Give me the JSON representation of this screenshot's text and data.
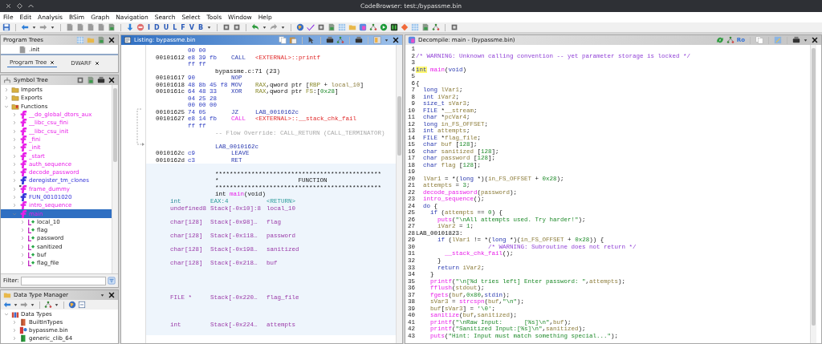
{
  "window": {
    "title": "CodeBrowser: test:/bypassme.bin"
  },
  "menu": [
    "File",
    "Edit",
    "Analysis",
    "BSim",
    "Graph",
    "Navigation",
    "Search",
    "Select",
    "Tools",
    "Window",
    "Help"
  ],
  "toolbar": {
    "letters": [
      "I",
      "D",
      "U",
      "L",
      "F",
      "V",
      "B"
    ]
  },
  "program_trees": {
    "title": "Program Trees",
    "focused": false,
    "rows": [
      ".init"
    ],
    "tabs": [
      {
        "label": "Program Tree",
        "selected": true
      },
      {
        "label": "DWARF",
        "selected": false
      }
    ]
  },
  "symbol_tree": {
    "title": "Symbol Tree",
    "focused": false,
    "items": [
      {
        "label": "Imports",
        "kind": "folder",
        "expanded": false,
        "selected": false
      },
      {
        "label": "Exports",
        "kind": "folder",
        "expanded": false,
        "selected": false
      },
      {
        "label": "Functions",
        "kind": "folder",
        "expanded": true,
        "selected": false,
        "children": [
          {
            "label": "__do_global_dtors_aux",
            "kind": "function",
            "color": "#e81ee8",
            "expanded": false,
            "selected": false
          },
          {
            "label": "__libc_csu_fini",
            "kind": "function",
            "color": "#e81ee8",
            "expanded": false,
            "selected": false
          },
          {
            "label": "__libc_csu_init",
            "kind": "function",
            "color": "#e81ee8",
            "expanded": false,
            "selected": false
          },
          {
            "label": "_fini",
            "kind": "function",
            "color": "#e81ee8",
            "expanded": false,
            "selected": false
          },
          {
            "label": "_init",
            "kind": "function",
            "color": "#e81ee8",
            "expanded": false,
            "selected": false
          },
          {
            "label": "_start",
            "kind": "function",
            "color": "#e81ee8",
            "expanded": false,
            "selected": false
          },
          {
            "label": "auth_sequence",
            "kind": "function",
            "color": "#e81ee8",
            "expanded": false,
            "selected": false
          },
          {
            "label": "decode_password",
            "kind": "function",
            "color": "#e81ee8",
            "expanded": false,
            "selected": false
          },
          {
            "label": "deregister_tm_clones",
            "kind": "function",
            "color": "#3434d8",
            "expanded": false,
            "selected": false
          },
          {
            "label": "frame_dummy",
            "kind": "function-marked",
            "color": "#e81ee8",
            "expanded": false,
            "selected": false
          },
          {
            "label": "FUN_00101020",
            "kind": "function",
            "color": "#3434d8",
            "expanded": false,
            "selected": false
          },
          {
            "label": "intro_sequence",
            "kind": "function",
            "color": "#e81ee8",
            "expanded": false,
            "selected": false
          },
          {
            "label": "main",
            "kind": "function",
            "color": "#e81ee8",
            "expanded": true,
            "selected": true,
            "children": [
              {
                "label": "local_10",
                "kind": "variable",
                "expanded": false,
                "selected": false
              },
              {
                "label": "flag",
                "kind": "variable",
                "expanded": false,
                "selected": false
              },
              {
                "label": "password",
                "kind": "variable",
                "expanded": false,
                "selected": false
              },
              {
                "label": "sanitized",
                "kind": "variable",
                "expanded": false,
                "selected": false
              },
              {
                "label": "buf",
                "kind": "variable",
                "expanded": false,
                "selected": false
              },
              {
                "label": "flag_file",
                "kind": "variable",
                "expanded": false,
                "selected": false
              }
            ]
          }
        ]
      }
    ],
    "filter": {
      "label": "Filter:"
    }
  },
  "data_type_manager": {
    "title": "Data Type Manager",
    "focused": false,
    "items": [
      {
        "label": "Data Types",
        "kind": "root",
        "expanded": true,
        "selected": false,
        "children": [
          {
            "label": "BuiltInTypes",
            "kind": "builtin",
            "expanded": false,
            "selected": false
          },
          {
            "label": "bypassme.bin",
            "kind": "program",
            "expanded": false,
            "selected": false
          },
          {
            "label": "generic_clib_64",
            "kind": "archive",
            "expanded": false,
            "selected": false
          }
        ]
      }
    ]
  },
  "listing": {
    "title": "Listing:  bypassme.bin",
    "focused": true,
    "blocks": [
      {
        "kind": "code",
        "lines": [
          {
            "kind": "bytes",
            "bytes": "00 00"
          },
          {
            "kind": "instr",
            "addr": "00101612",
            "bytes": "e8 39 fb",
            "mnem": {
              "kind": "k",
              "text": "CALL"
            },
            "ops": [
              {
                "kind": "x",
                "text": "<EXTERNAL>::printf"
              }
            ]
          },
          {
            "kind": "bytes",
            "bytes": "ff ff"
          },
          {
            "kind": "source",
            "text": "bypassme.c:71 (23)"
          },
          {
            "kind": "instr",
            "addr": "00101617",
            "bytes": "90",
            "mnem": {
              "kind": "k",
              "text": "NOP"
            }
          },
          {
            "kind": "instr",
            "addr": "00101618",
            "bytes": "48 8b 45 f8",
            "mnem": {
              "kind": "k",
              "text": "MOV"
            },
            "ops": [
              {
                "kind": "r",
                "text": "RAX"
              },
              {
                "kind": "p",
                "text": ",qword ptr ["
              },
              {
                "kind": "r",
                "text": "RBP"
              },
              {
                "kind": "p",
                "text": " +"
              },
              {
                "kind": "v",
                "text": " local_10"
              },
              {
                "kind": "p",
                "text": "]"
              }
            ]
          },
          {
            "kind": "instr",
            "addr": "0010161c",
            "bytes": "64 48 33",
            "mnem": {
              "kind": "k",
              "text": "XOR"
            },
            "ops": [
              {
                "kind": "r",
                "text": "RAX"
              },
              {
                "kind": "p",
                "text": ",qword ptr"
              },
              {
                "kind": "r",
                "text": " FS"
              },
              {
                "kind": "p",
                "text": ":["
              },
              {
                "kind": "n",
                "text": "0x28"
              },
              {
                "kind": "p",
                "text": "]"
              }
            ]
          },
          {
            "kind": "bytes",
            "bytes": "04 25 28"
          },
          {
            "kind": "bytes",
            "bytes": "00 00 00"
          },
          {
            "kind": "instr",
            "addr": "00101625",
            "bytes": "74 05",
            "mnem": {
              "kind": "k",
              "text": "JZ"
            },
            "ops": [
              {
                "kind": "l",
                "text": "LAB_0010162c"
              }
            ]
          },
          {
            "kind": "instr",
            "addr": "00101627",
            "bytes": "e8 14 fb",
            "mnem": {
              "kind": "f",
              "text": "CALL"
            },
            "ops": [
              {
                "kind": "x",
                "text": "<EXTERNAL>::__stack_chk_fail"
              }
            ]
          },
          {
            "kind": "bytes",
            "bytes": "ff ff"
          },
          {
            "kind": "flow",
            "text": "-- Flow Override: CALL_RETURN (CALL_TERMINATOR)"
          },
          {
            "kind": "blank"
          },
          {
            "kind": "label",
            "text": "LAB_0010162c"
          },
          {
            "kind": "instr",
            "addr": "0010162c",
            "bytes": "c9",
            "mnem": {
              "kind": "k",
              "text": "LEAVE"
            }
          },
          {
            "kind": "instr",
            "addr": "0010162d",
            "bytes": "c3",
            "mnem": {
              "kind": "k",
              "text": "RET"
            }
          }
        ]
      },
      {
        "kind": "function",
        "lines": [
          {
            "kind": "blank"
          },
          {
            "kind": "stars",
            "text": "**********************************************"
          },
          {
            "kind": "stars",
            "text": "*                      FUNCTION"
          },
          {
            "kind": "stars",
            "text": "**********************************************"
          },
          {
            "kind": "signature",
            "tokens": [
              {
                "kind": "p",
                "text": "int"
              },
              {
                "kind": "f",
                "text": " main"
              },
              {
                "kind": "p",
                "text": "(void)"
              }
            ]
          },
          {
            "kind": "return-var",
            "type": "int",
            "storage": "EAX:4",
            "name": "<RETURN>"
          },
          {
            "kind": "var",
            "type": "undefined8",
            "storage": "Stack[-0x10]:8",
            "name": "local_10"
          },
          {
            "kind": "blank"
          },
          {
            "kind": "var",
            "type": "char[128]",
            "storage": "Stack[-0x98]…",
            "name": "flag"
          },
          {
            "kind": "blank"
          },
          {
            "kind": "var",
            "type": "char[128]",
            "storage": "Stack[-0x118…",
            "name": "password"
          },
          {
            "kind": "blank"
          },
          {
            "kind": "var",
            "type": "char[128]",
            "storage": "Stack[-0x198…",
            "name": "sanitized"
          },
          {
            "kind": "blank"
          },
          {
            "kind": "var",
            "type": "char[128]",
            "storage": "Stack[-0x218…",
            "name": "buf"
          },
          {
            "kind": "blank"
          },
          {
            "kind": "blank"
          },
          {
            "kind": "blank"
          },
          {
            "kind": "blank"
          },
          {
            "kind": "var",
            "type": "FILE *",
            "storage": "Stack[-0x220…",
            "name": "flag_file"
          },
          {
            "kind": "blank"
          },
          {
            "kind": "blank"
          },
          {
            "kind": "blank"
          },
          {
            "kind": "var",
            "type": "int",
            "storage": "Stack[-0x224…",
            "name": "attempts"
          },
          {
            "kind": "blank"
          }
        ]
      }
    ]
  },
  "decompile": {
    "title": "Decompile: main -  (bypassme.bin)",
    "focused": false,
    "toolbar_text": "Ro",
    "lines": [
      {
        "num": "1"
      },
      {
        "num": "2",
        "tokens": [
          {
            "kind": "c",
            "text": "/* WARNING: Unknown calling convention -- yet parameter storage is locked */"
          }
        ]
      },
      {
        "num": "3"
      },
      {
        "num": "4",
        "tokens": [
          {
            "kind": "h",
            "text": "int"
          },
          {
            "kind": "f",
            "text": " main"
          },
          {
            "kind": "p",
            "text": "("
          },
          {
            "kind": "k",
            "text": "void"
          },
          {
            "kind": "p",
            "text": ")"
          }
        ]
      },
      {
        "num": "5"
      },
      {
        "num": "6",
        "tokens": [
          {
            "kind": "p",
            "text": "{"
          }
        ]
      },
      {
        "num": "7",
        "tokens": [
          {
            "kind": "k",
            "text": "  long"
          },
          {
            "kind": "v",
            "text": " lVar1"
          },
          {
            "kind": "p",
            "text": ";"
          }
        ]
      },
      {
        "num": "8",
        "tokens": [
          {
            "kind": "k",
            "text": "  int"
          },
          {
            "kind": "v",
            "text": " iVar2"
          },
          {
            "kind": "p",
            "text": ";"
          }
        ]
      },
      {
        "num": "9",
        "tokens": [
          {
            "kind": "k",
            "text": "  size_t"
          },
          {
            "kind": "v",
            "text": " sVar3"
          },
          {
            "kind": "p",
            "text": ";"
          }
        ]
      },
      {
        "num": "10",
        "tokens": [
          {
            "kind": "k",
            "text": "  FILE"
          },
          {
            "kind": "p",
            "text": " *"
          },
          {
            "kind": "v",
            "text": "__stream"
          },
          {
            "kind": "p",
            "text": ";"
          }
        ]
      },
      {
        "num": "11",
        "tokens": [
          {
            "kind": "k",
            "text": "  char"
          },
          {
            "kind": "p",
            "text": " *"
          },
          {
            "kind": "v",
            "text": "pcVar4"
          },
          {
            "kind": "p",
            "text": ";"
          }
        ]
      },
      {
        "num": "12",
        "tokens": [
          {
            "kind": "k",
            "text": "  long"
          },
          {
            "kind": "v",
            "text": " in_FS_OFFSET"
          },
          {
            "kind": "p",
            "text": ";"
          }
        ]
      },
      {
        "num": "13",
        "tokens": [
          {
            "kind": "k",
            "text": "  int"
          },
          {
            "kind": "v",
            "text": " attempts"
          },
          {
            "kind": "p",
            "text": ";"
          }
        ]
      },
      {
        "num": "14",
        "tokens": [
          {
            "kind": "k",
            "text": "  FILE"
          },
          {
            "kind": "p",
            "text": " *"
          },
          {
            "kind": "v",
            "text": "flag_file"
          },
          {
            "kind": "p",
            "text": ";"
          }
        ]
      },
      {
        "num": "15",
        "tokens": [
          {
            "kind": "k",
            "text": "  char"
          },
          {
            "kind": "v",
            "text": " buf"
          },
          {
            "kind": "p",
            "text": " ["
          },
          {
            "kind": "n",
            "text": "128"
          },
          {
            "kind": "p",
            "text": "];"
          }
        ]
      },
      {
        "num": "16",
        "tokens": [
          {
            "kind": "k",
            "text": "  char"
          },
          {
            "kind": "v",
            "text": " sanitized"
          },
          {
            "kind": "p",
            "text": " ["
          },
          {
            "kind": "n",
            "text": "128"
          },
          {
            "kind": "p",
            "text": "];"
          }
        ]
      },
      {
        "num": "17",
        "tokens": [
          {
            "kind": "k",
            "text": "  char"
          },
          {
            "kind": "v",
            "text": " password"
          },
          {
            "kind": "p",
            "text": " ["
          },
          {
            "kind": "n",
            "text": "128"
          },
          {
            "kind": "p",
            "text": "];"
          }
        ]
      },
      {
        "num": "18",
        "tokens": [
          {
            "kind": "k",
            "text": "  char"
          },
          {
            "kind": "v",
            "text": " flag"
          },
          {
            "kind": "p",
            "text": " ["
          },
          {
            "kind": "n",
            "text": "128"
          },
          {
            "kind": "p",
            "text": "];"
          }
        ]
      },
      {
        "num": "19"
      },
      {
        "num": "20",
        "tokens": [
          {
            "kind": "v",
            "text": "  lVar1"
          },
          {
            "kind": "p",
            "text": " = *("
          },
          {
            "kind": "k",
            "text": "long"
          },
          {
            "kind": "p",
            "text": " *)("
          },
          {
            "kind": "v",
            "text": "in_FS_OFFSET"
          },
          {
            "kind": "p",
            "text": " +"
          },
          {
            "kind": "n",
            "text": " 0x28"
          },
          {
            "kind": "p",
            "text": ");"
          }
        ]
      },
      {
        "num": "21",
        "tokens": [
          {
            "kind": "v",
            "text": "  attempts"
          },
          {
            "kind": "p",
            "text": " ="
          },
          {
            "kind": "n",
            "text": " 3"
          },
          {
            "kind": "p",
            "text": ";"
          }
        ]
      },
      {
        "num": "22",
        "tokens": [
          {
            "kind": "f",
            "text": "  decode_password"
          },
          {
            "kind": "p",
            "text": "("
          },
          {
            "kind": "v",
            "text": "password"
          },
          {
            "kind": "p",
            "text": ");"
          }
        ]
      },
      {
        "num": "23",
        "tokens": [
          {
            "kind": "f",
            "text": "  intro_sequence"
          },
          {
            "kind": "p",
            "text": "();"
          }
        ]
      },
      {
        "num": "24",
        "tokens": [
          {
            "kind": "k",
            "text": "  do"
          },
          {
            "kind": "p",
            "text": " {"
          }
        ]
      },
      {
        "num": "25",
        "tokens": [
          {
            "kind": "k",
            "text": "    if"
          },
          {
            "kind": "p",
            "text": " ("
          },
          {
            "kind": "v",
            "text": "attempts"
          },
          {
            "kind": "p",
            "text": " =="
          },
          {
            "kind": "n",
            "text": " 0"
          },
          {
            "kind": "p",
            "text": ") {"
          }
        ]
      },
      {
        "num": "26",
        "tokens": [
          {
            "kind": "f",
            "text": "      puts"
          },
          {
            "kind": "p",
            "text": "("
          },
          {
            "kind": "n",
            "text": "\"\\nAll attempts used. Try harder!\""
          },
          {
            "kind": "p",
            "text": ");"
          }
        ]
      },
      {
        "num": "27",
        "tokens": [
          {
            "kind": "v",
            "text": "      iVar2"
          },
          {
            "kind": "p",
            "text": " ="
          },
          {
            "kind": "n",
            "text": " 1"
          },
          {
            "kind": "p",
            "text": ";"
          }
        ]
      },
      {
        "num": "28",
        "tokens": [
          {
            "kind": "p",
            "text": "LAB_00101823:"
          }
        ]
      },
      {
        "num": "29",
        "tokens": [
          {
            "kind": "k",
            "text": "      if"
          },
          {
            "kind": "p",
            "text": " ("
          },
          {
            "kind": "v",
            "text": "lVar1"
          },
          {
            "kind": "p",
            "text": " != *("
          },
          {
            "kind": "k",
            "text": "long"
          },
          {
            "kind": "p",
            "text": " *)("
          },
          {
            "kind": "v",
            "text": "in_FS_OFFSET"
          },
          {
            "kind": "p",
            "text": " +"
          },
          {
            "kind": "n",
            "text": " 0x28"
          },
          {
            "kind": "p",
            "text": ")) {"
          }
        ]
      },
      {
        "num": "30",
        "tokens": [
          {
            "kind": "c",
            "text": "                    /* WARNING: Subroutine does not return */"
          }
        ]
      },
      {
        "num": "31",
        "tokens": [
          {
            "kind": "f",
            "text": "        __stack_chk_fail"
          },
          {
            "kind": "p",
            "text": "();"
          }
        ]
      },
      {
        "num": "32",
        "tokens": [
          {
            "kind": "p",
            "text": "      }"
          }
        ]
      },
      {
        "num": "33",
        "tokens": [
          {
            "kind": "k",
            "text": "      return"
          },
          {
            "kind": "v",
            "text": " iVar2"
          },
          {
            "kind": "p",
            "text": ";"
          }
        ]
      },
      {
        "num": "34",
        "tokens": [
          {
            "kind": "p",
            "text": "    }"
          }
        ]
      },
      {
        "num": "35",
        "tokens": [
          {
            "kind": "f",
            "text": "    printf"
          },
          {
            "kind": "p",
            "text": "("
          },
          {
            "kind": "n",
            "text": "\"\\n[%d tries left] Enter password: \""
          },
          {
            "kind": "p",
            "text": ","
          },
          {
            "kind": "v",
            "text": "attempts"
          },
          {
            "kind": "p",
            "text": ");"
          }
        ]
      },
      {
        "num": "36",
        "tokens": [
          {
            "kind": "f",
            "text": "    fflush"
          },
          {
            "kind": "p",
            "text": "("
          },
          {
            "kind": "v",
            "text": "stdout"
          },
          {
            "kind": "p",
            "text": ");"
          }
        ]
      },
      {
        "num": "37",
        "tokens": [
          {
            "kind": "f",
            "text": "    fgets"
          },
          {
            "kind": "p",
            "text": "("
          },
          {
            "kind": "v",
            "text": "buf"
          },
          {
            "kind": "p",
            "text": ","
          },
          {
            "kind": "n",
            "text": "0x80"
          },
          {
            "kind": "p",
            "text": ","
          },
          {
            "kind": "g",
            "text": "stdin"
          },
          {
            "kind": "p",
            "text": ");"
          }
        ]
      },
      {
        "num": "38",
        "tokens": [
          {
            "kind": "v",
            "text": "    sVar3"
          },
          {
            "kind": "p",
            "text": " ="
          },
          {
            "kind": "f",
            "text": " strcspn"
          },
          {
            "kind": "p",
            "text": "("
          },
          {
            "kind": "v",
            "text": "buf"
          },
          {
            "kind": "p",
            "text": ","
          },
          {
            "kind": "n",
            "text": "\"\\n\""
          },
          {
            "kind": "p",
            "text": ");"
          }
        ]
      },
      {
        "num": "39",
        "tokens": [
          {
            "kind": "v",
            "text": "    buf"
          },
          {
            "kind": "p",
            "text": "["
          },
          {
            "kind": "v",
            "text": "sVar3"
          },
          {
            "kind": "p",
            "text": "] ="
          },
          {
            "kind": "n",
            "text": " '\\0'"
          },
          {
            "kind": "p",
            "text": ";"
          }
        ]
      },
      {
        "num": "40",
        "tokens": [
          {
            "kind": "f",
            "text": "    sanitize"
          },
          {
            "kind": "p",
            "text": "("
          },
          {
            "kind": "v",
            "text": "buf"
          },
          {
            "kind": "p",
            "text": ","
          },
          {
            "kind": "v",
            "text": "sanitized"
          },
          {
            "kind": "p",
            "text": ");"
          }
        ]
      },
      {
        "num": "41",
        "tokens": [
          {
            "kind": "f",
            "text": "    printf"
          },
          {
            "kind": "p",
            "text": "("
          },
          {
            "kind": "n",
            "text": "\"\\nRaw Input:      [%s]\\n\""
          },
          {
            "kind": "p",
            "text": ","
          },
          {
            "kind": "v",
            "text": "buf"
          },
          {
            "kind": "p",
            "text": ");"
          }
        ]
      },
      {
        "num": "42",
        "tokens": [
          {
            "kind": "f",
            "text": "    printf"
          },
          {
            "kind": "p",
            "text": "("
          },
          {
            "kind": "n",
            "text": "\"Sanitized Input:[%s]\\n\""
          },
          {
            "kind": "p",
            "text": ","
          },
          {
            "kind": "v",
            "text": "sanitized"
          },
          {
            "kind": "p",
            "text": ");"
          }
        ]
      },
      {
        "num": "43",
        "tokens": [
          {
            "kind": "f",
            "text": "    puts"
          },
          {
            "kind": "p",
            "text": "("
          },
          {
            "kind": "n",
            "text": "\"Hint: Input must match something special...\""
          },
          {
            "kind": "p",
            "text": ");"
          }
        ]
      }
    ]
  }
}
